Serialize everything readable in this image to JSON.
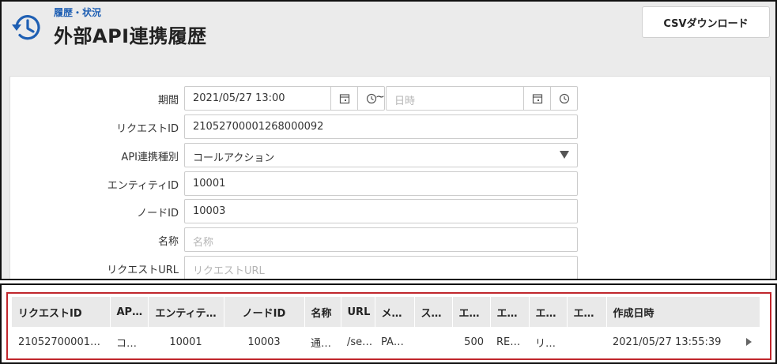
{
  "header": {
    "breadcrumb": "履歴・状況",
    "title": "外部API連携履歴",
    "csv_button": "CSVダウンロード",
    "icon": "history-icon"
  },
  "form": {
    "period": {
      "label": "期間",
      "start_value": "2021/05/27 13:00",
      "separator": "~",
      "end_placeholder": "日時"
    },
    "request_id": {
      "label": "リクエストID",
      "value": "21052700001268000092"
    },
    "api_type": {
      "label": "API連携種別",
      "value": "コールアクション"
    },
    "entity_id": {
      "label": "エンティティID",
      "value": "10001"
    },
    "node_id": {
      "label": "ノードID",
      "value": "10003"
    },
    "name": {
      "label": "名称",
      "placeholder": "名称"
    },
    "request_url": {
      "label": "リクエストURL",
      "placeholder": "リクエストURL"
    }
  },
  "table": {
    "columns": [
      "リクエストID",
      "AP…",
      "エンティテ…",
      "ノードID",
      "名称",
      "URL",
      "メ…",
      "ス…",
      "エ…",
      "エ…",
      "エ…",
      "エ…",
      "作成日時"
    ],
    "rows": [
      [
        "21052700001…",
        "コ…",
        "10001",
        "10003",
        "通…",
        "/se…",
        "PA…",
        "",
        "500",
        "RE…",
        "リ…",
        "",
        "2021/05/27 13:55:39"
      ]
    ]
  }
}
